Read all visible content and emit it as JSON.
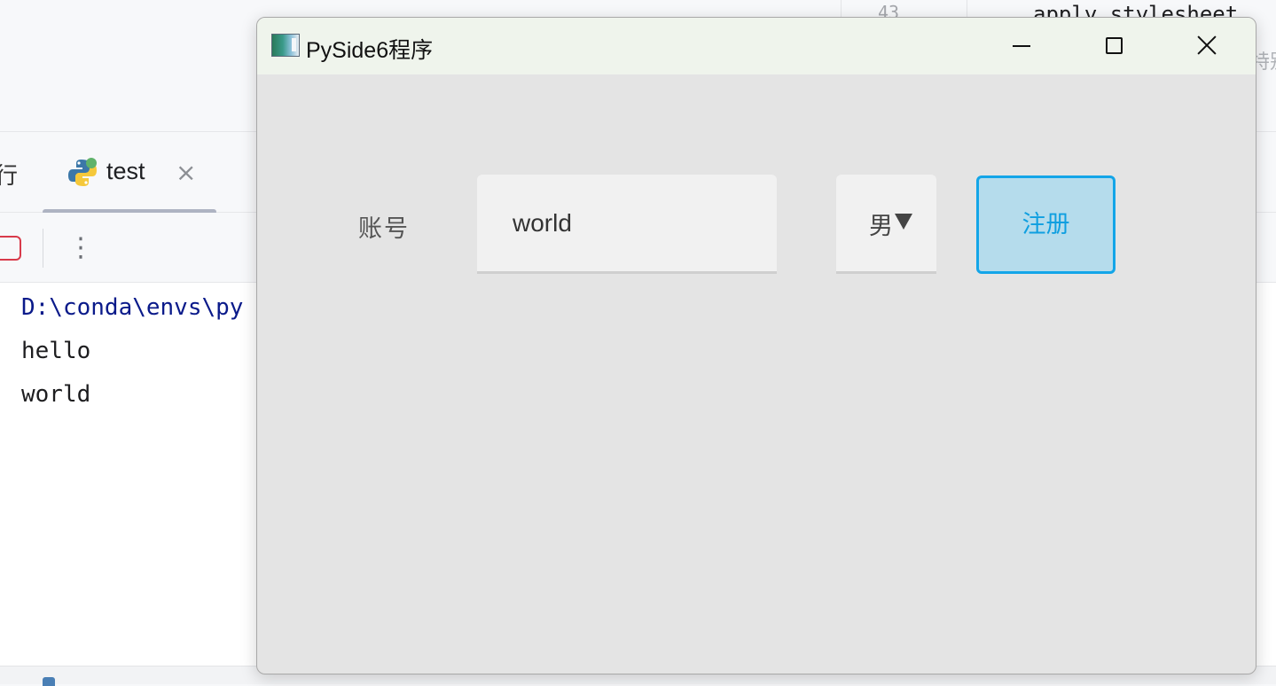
{
  "ide": {
    "line_number": "43",
    "code_snippet": "apply_stylesheet",
    "code_hint": "特别",
    "partial_tab_label": "行",
    "tab": {
      "label": "test",
      "close": "×"
    },
    "console": {
      "lines": [
        "D:\\conda\\envs\\py",
        "hello",
        "world"
      ]
    }
  },
  "window": {
    "title": "PySide6程序",
    "controls": {
      "minimize": "minimize",
      "maximize": "maximize",
      "close": "close"
    },
    "form": {
      "account_label": "账号",
      "account_value": "world",
      "gender_value": "男",
      "register_label": "注册"
    }
  },
  "colors": {
    "register_border": "#13a5e8",
    "register_bg": "#b5dcec",
    "titlebar_bg": "#eff4ec",
    "console_path": "#0a1a8a"
  }
}
